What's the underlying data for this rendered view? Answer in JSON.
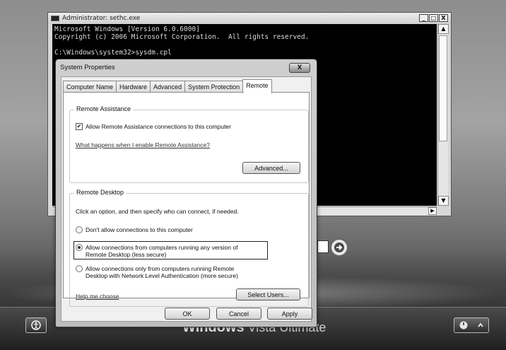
{
  "cmd": {
    "title": "Administrator: sethc.exe",
    "controls": [
      "_",
      "□",
      "X"
    ],
    "lines": [
      "Microsoft Windows [Version 6.0.6000]",
      "Copyright (c) 2006 Microsoft Corporation.  All rights reserved.",
      "",
      "C:\\Windows\\system32>sysdm.cpl"
    ]
  },
  "sysprop": {
    "title": "System Properties",
    "close": "X",
    "tabs": [
      "Computer Name",
      "Hardware",
      "Advanced",
      "System Protection",
      "Remote"
    ],
    "active_tab": "Remote",
    "remote_assistance": {
      "group": "Remote Assistance",
      "allow_label": "Allow Remote Assistance connections to this computer",
      "allow_checked": true,
      "link": "What happens when I enable Remote Assistance?",
      "advanced": "Advanced..."
    },
    "remote_desktop": {
      "group": "Remote Desktop",
      "intro": "Click an option, and then specify who can connect, if needed.",
      "opt1": "Don't allow connections to this computer",
      "opt2a": "Allow connections from computers running any version of",
      "opt2b": "Remote Desktop (less secure)",
      "opt3a": "Allow connections only from computers running Remote",
      "opt3b": "Desktop with Network Level Authentication (more secure)",
      "selected": 2,
      "help": "Help me choose",
      "select_users": "Select Users..."
    },
    "ok": "OK",
    "cancel": "Cancel",
    "apply": "Apply"
  },
  "logon": {
    "brand_bold": "Windows",
    "brand_light": "Vista",
    "brand_edition": "Ultimate"
  }
}
